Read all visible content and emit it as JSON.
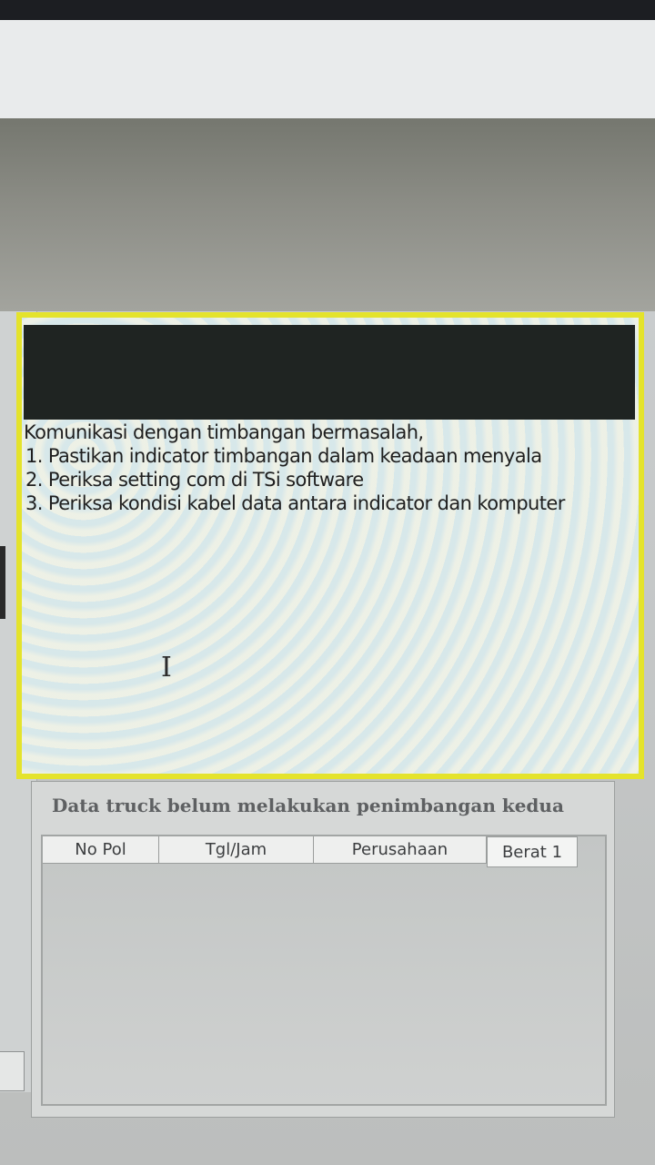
{
  "message": {
    "lines": [
      "Komunikasi dengan timbangan bermasalah,",
      "1. Pastikan indicator timbangan dalam keadaan menyala",
      "2. Periksa setting com di TSi software",
      "3. Periksa kondisi kabel data antara indicator dan komputer"
    ],
    "cursor_glyph": "I",
    "border_color": "#e4e32c",
    "header_color": "#1f2422"
  },
  "pending_trucks": {
    "title": "Data truck belum melakukan penimbangan kedua",
    "columns": [
      "No Pol",
      "Tgl/Jam",
      "Perusahaan",
      "Berat 1"
    ],
    "rows": []
  }
}
